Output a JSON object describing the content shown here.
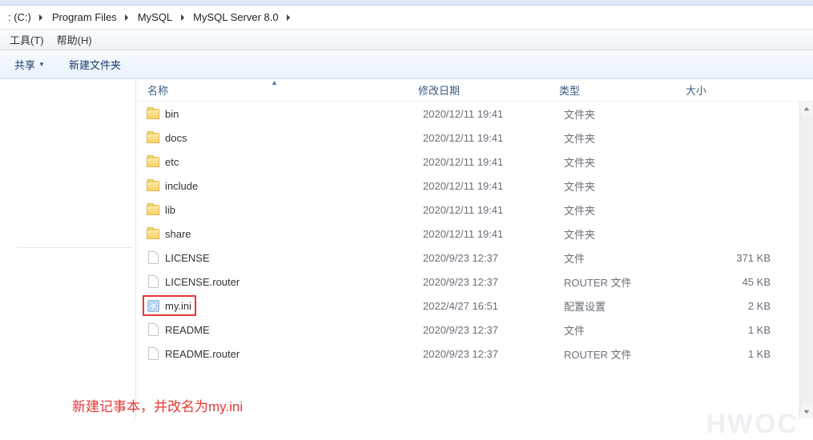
{
  "breadcrumb": {
    "segments": [
      {
        "label": ": (C:)"
      },
      {
        "label": "Program Files"
      },
      {
        "label": "MySQL"
      },
      {
        "label": "MySQL Server 8.0"
      }
    ]
  },
  "menu": {
    "tools": "工具(T)",
    "help": "帮助(H)"
  },
  "toolbar": {
    "share": "共享",
    "new_folder": "新建文件夹"
  },
  "columns": {
    "name": "名称",
    "modified": "修改日期",
    "type": "类型",
    "size": "大小"
  },
  "files": [
    {
      "icon": "folder",
      "name": "bin",
      "modified": "2020/12/11 19:41",
      "type": "文件夹",
      "size": ""
    },
    {
      "icon": "folder",
      "name": "docs",
      "modified": "2020/12/11 19:41",
      "type": "文件夹",
      "size": ""
    },
    {
      "icon": "folder",
      "name": "etc",
      "modified": "2020/12/11 19:41",
      "type": "文件夹",
      "size": ""
    },
    {
      "icon": "folder",
      "name": "include",
      "modified": "2020/12/11 19:41",
      "type": "文件夹",
      "size": ""
    },
    {
      "icon": "folder",
      "name": "lib",
      "modified": "2020/12/11 19:41",
      "type": "文件夹",
      "size": ""
    },
    {
      "icon": "folder",
      "name": "share",
      "modified": "2020/12/11 19:41",
      "type": "文件夹",
      "size": ""
    },
    {
      "icon": "file",
      "name": "LICENSE",
      "modified": "2020/9/23 12:37",
      "type": "文件",
      "size": "371 KB"
    },
    {
      "icon": "file",
      "name": "LICENSE.router",
      "modified": "2020/9/23 12:37",
      "type": "ROUTER 文件",
      "size": "45 KB"
    },
    {
      "icon": "ini",
      "name": "my.ini",
      "modified": "2022/4/27 16:51",
      "type": "配置设置",
      "size": "2 KB",
      "highlight": true
    },
    {
      "icon": "file",
      "name": "README",
      "modified": "2020/9/23 12:37",
      "type": "文件",
      "size": "1 KB"
    },
    {
      "icon": "file",
      "name": "README.router",
      "modified": "2020/9/23 12:37",
      "type": "ROUTER 文件",
      "size": "1 KB"
    }
  ],
  "annotation": "新建记事本，并改名为my.ini",
  "watermark": "HWOC"
}
